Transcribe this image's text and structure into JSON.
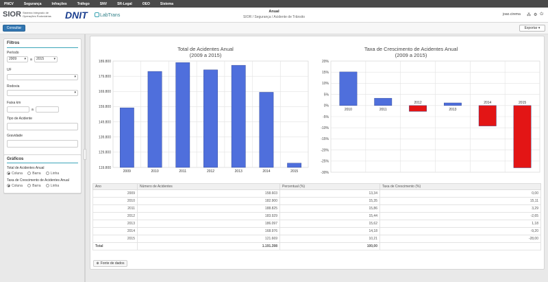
{
  "nav": [
    "PNCV",
    "Segurança",
    "Infrações",
    "Tráfego",
    "SNV",
    "SR-Legal",
    "OEO",
    "Sistema"
  ],
  "brand": {
    "sior": "SIOR",
    "sior_sub": "Sistema Integrado de Operações Rodoviárias",
    "dnit": "DNIT",
    "labtrans": "LabTrans"
  },
  "header": {
    "title": "Anual",
    "breadcrumb": "SIOR / Segurança / Acidente de Trânsito",
    "user": "joao.cirema"
  },
  "toolbar": {
    "consultar": "Consultar",
    "exportar": "Exportar ▾"
  },
  "filters": {
    "title": "Filtros",
    "periodo_label": "Período",
    "periodo_from": "2009",
    "periodo_sep": "a",
    "periodo_to": "2015",
    "uf_label": "UF",
    "rodovia_label": "Rodovia",
    "faixa_label": "Faixa km",
    "faixa_sep": "a",
    "tipo_label": "Tipo de Acidente",
    "gravidade_label": "Gravidade"
  },
  "graficos": {
    "title": "Gráficos",
    "g1_label": "Total de Acidentes Anual",
    "g2_label": "Taxa de Crescimento de Acidentes Anual",
    "opts": [
      "Coluna",
      "Barra",
      "Linha"
    ]
  },
  "chart_data": [
    {
      "type": "bar",
      "title": "Total de Acidentes Anual",
      "subtitle": "(2009 a 2015)",
      "categories": [
        "2009",
        "2010",
        "2011",
        "2012",
        "2013",
        "2014",
        "2015"
      ],
      "values": [
        158603,
        182900,
        188825,
        183929,
        186997,
        168976,
        121669
      ],
      "ylim": [
        118800,
        189800
      ],
      "yticks": [
        "119.800",
        "129.800",
        "139.800",
        "149.800",
        "159.800",
        "169.800",
        "179.800",
        "189.800"
      ],
      "color": "#4f6fdc"
    },
    {
      "type": "bar",
      "title": "Taxa de Crescimento de Acidentes Anual",
      "subtitle": "(2009 a 2015)",
      "categories": [
        "2010",
        "2011",
        "2012",
        "2013",
        "2014",
        "2015"
      ],
      "values": [
        15.11,
        3.29,
        -2.65,
        1.18,
        -9.2,
        -28.0
      ],
      "ylim": [
        -30,
        20
      ],
      "yticks": [
        "-30%",
        "-25%",
        "-20%",
        "-15%",
        "-10%",
        "-5%",
        "0%",
        "5%",
        "10%",
        "15%",
        "20%"
      ],
      "pos_color": "#4f6fdc",
      "neg_color": "#e31515"
    }
  ],
  "table": {
    "headers": [
      "Ano",
      "Número de Acidentes",
      "Percentual (%)",
      "Taxa de Crescimento (%)"
    ],
    "rows": [
      [
        "2009",
        "158.603",
        "13,34",
        "0,00"
      ],
      [
        "2010",
        "182.900",
        "15,35",
        "15,11"
      ],
      [
        "2011",
        "188.825",
        "15,86",
        "3,29"
      ],
      [
        "2012",
        "183.929",
        "15,44",
        "-2,65"
      ],
      [
        "2013",
        "186.097",
        "15,62",
        "1,18"
      ],
      [
        "2014",
        "168.976",
        "14,18",
        "-9,20"
      ],
      [
        "2015",
        "121.669",
        "10,21",
        "-28,00"
      ]
    ],
    "total": [
      "Total",
      "1.191.398",
      "100,00",
      ""
    ]
  },
  "fonte": "Fonte de dados"
}
